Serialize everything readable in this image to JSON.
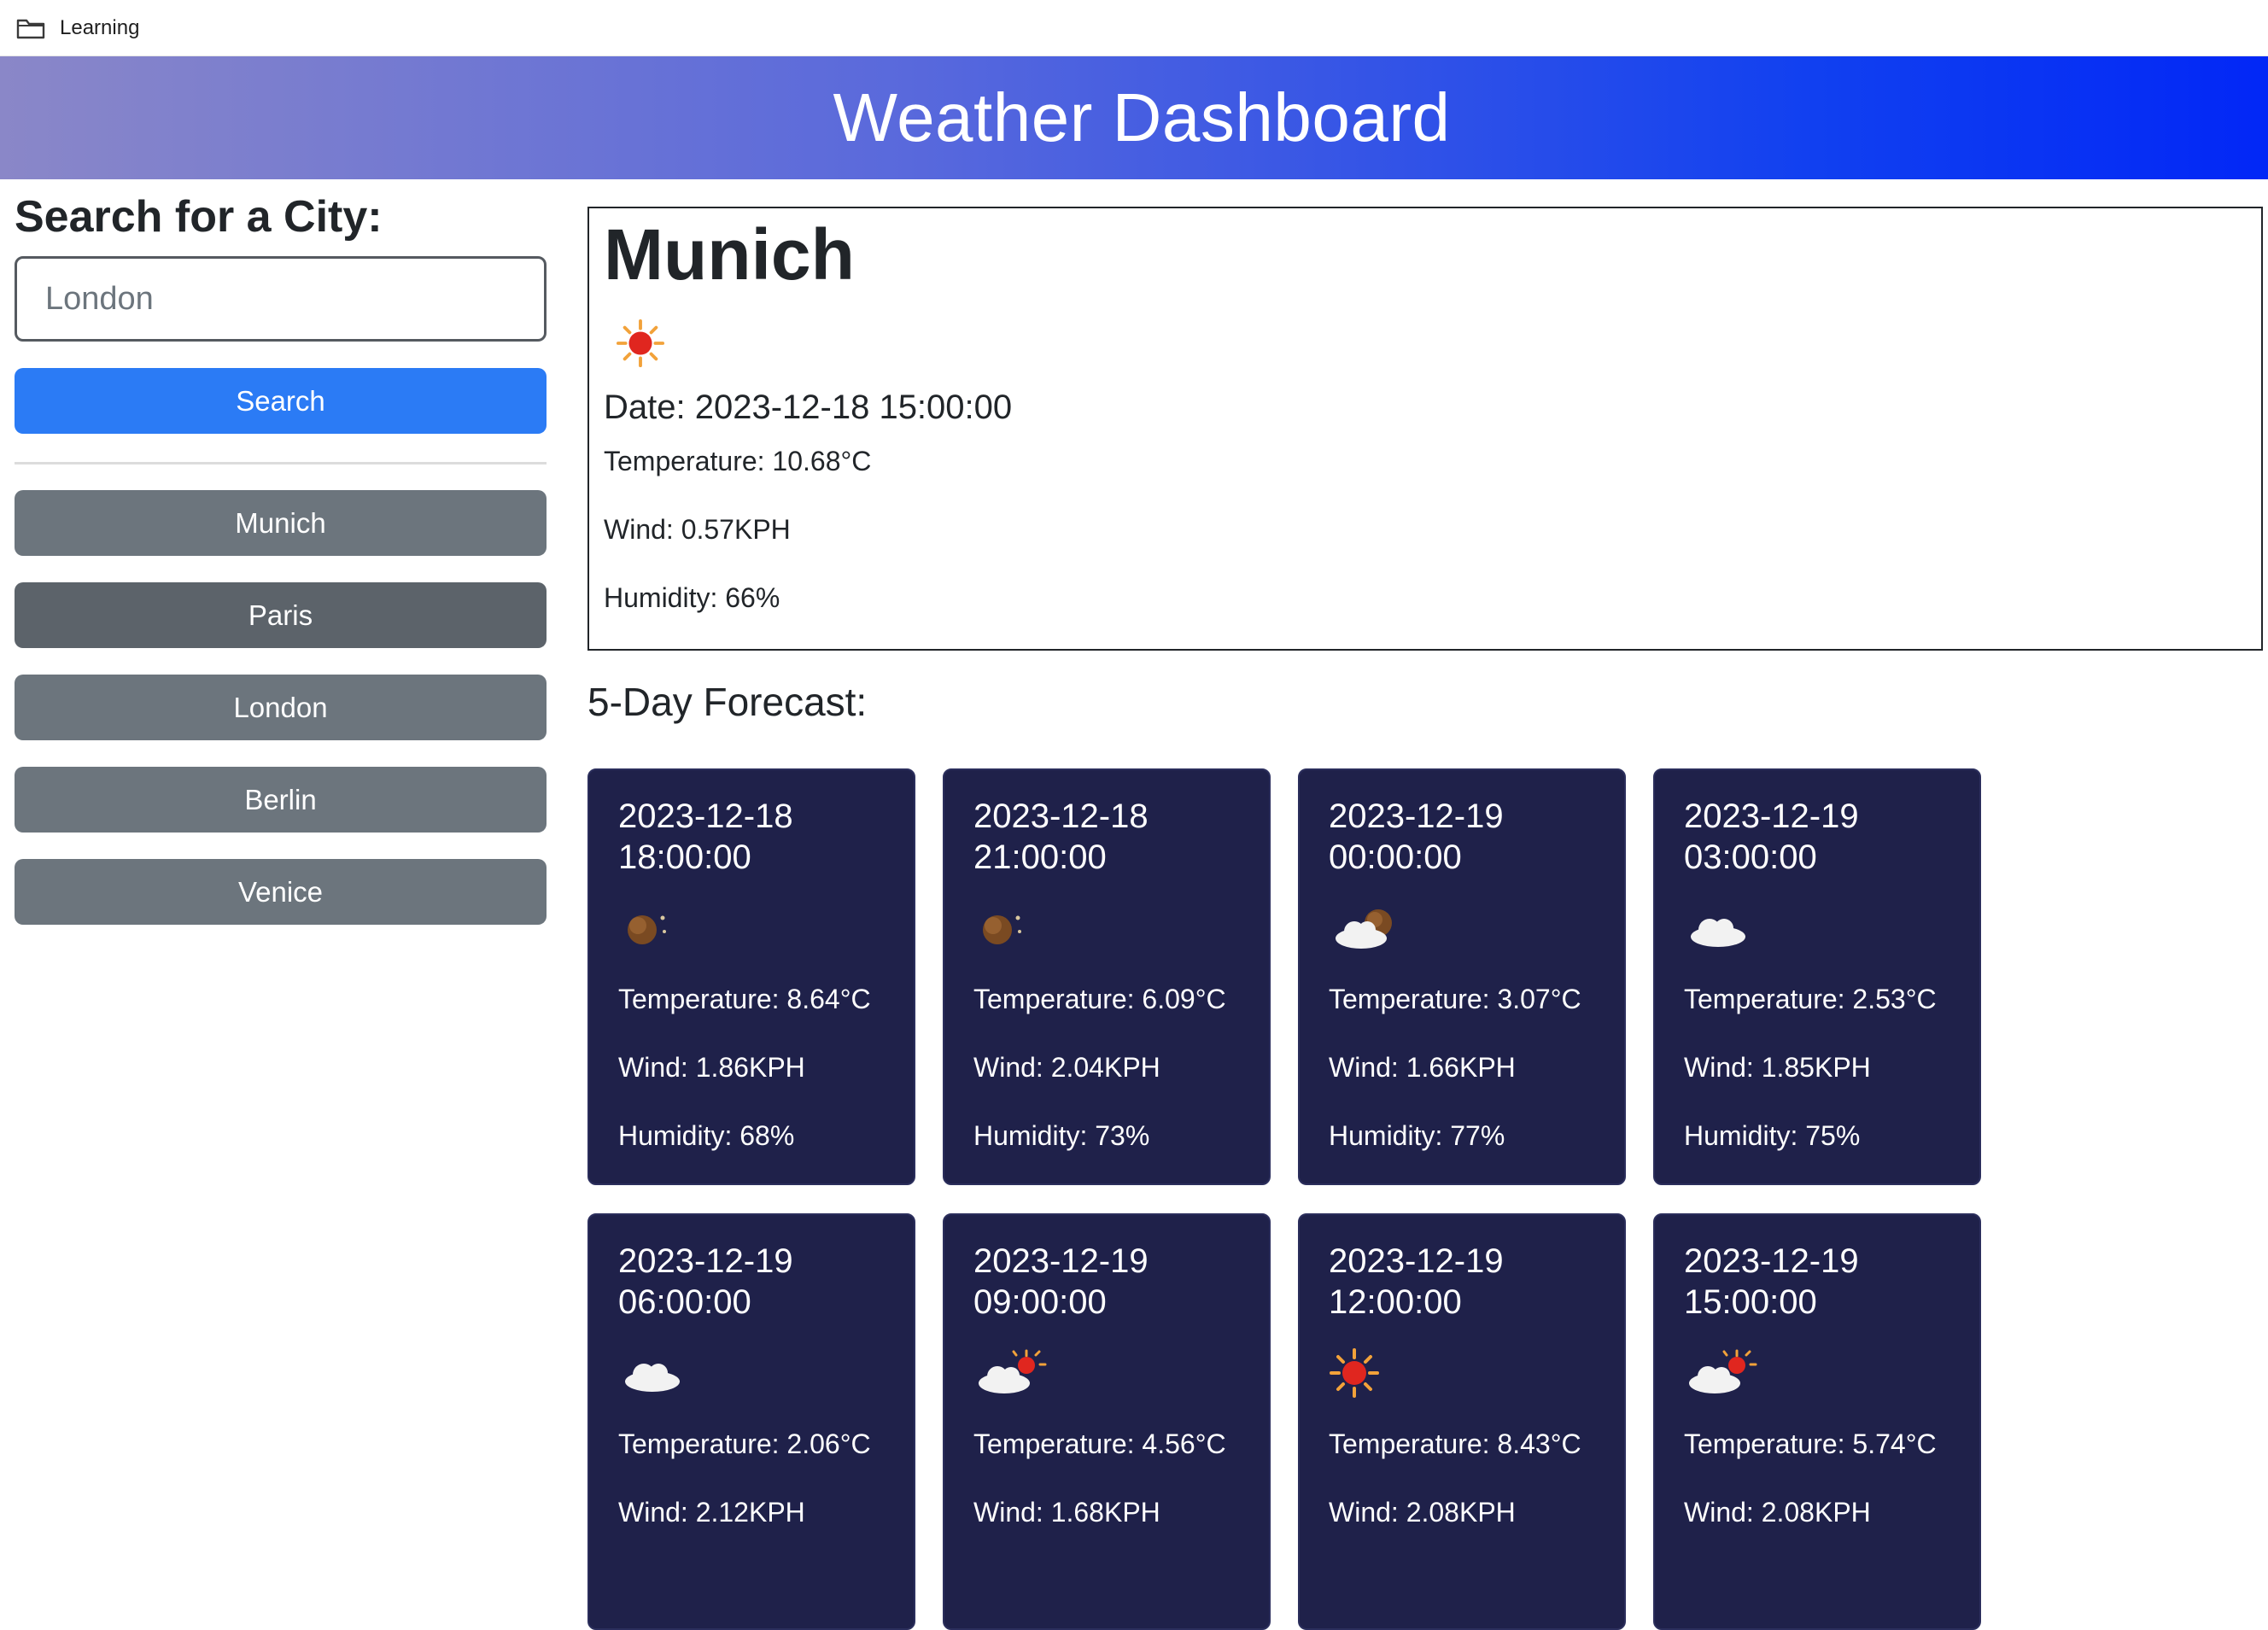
{
  "topbar": {
    "label": "Learning"
  },
  "header": {
    "title": "Weather Dashboard"
  },
  "sidebar": {
    "heading": "Search for a City:",
    "search_placeholder": "London",
    "search_button": "Search",
    "history": [
      "Munich",
      "Paris",
      "London",
      "Berlin",
      "Venice"
    ]
  },
  "current": {
    "city": "Munich",
    "icon": "sun-icon",
    "date": "Date: 2023-12-18 15:00:00",
    "temperature": "Temperature: 10.68°C",
    "wind": "Wind: 0.57KPH",
    "humidity": "Humidity: 66%"
  },
  "forecast": {
    "title": "5-Day Forecast:",
    "cards": [
      {
        "date": "2023-12-18 18:00:00",
        "icon": "moon-icon",
        "temperature": "Temperature: 8.64°C",
        "wind": "Wind: 1.86KPH",
        "humidity": "Humidity: 68%"
      },
      {
        "date": "2023-12-18 21:00:00",
        "icon": "moon-icon",
        "temperature": "Temperature: 6.09°C",
        "wind": "Wind: 2.04KPH",
        "humidity": "Humidity: 73%"
      },
      {
        "date": "2023-12-19 00:00:00",
        "icon": "cloud-moon-icon",
        "temperature": "Temperature: 3.07°C",
        "wind": "Wind: 1.66KPH",
        "humidity": "Humidity: 77%"
      },
      {
        "date": "2023-12-19 03:00:00",
        "icon": "cloud-icon",
        "temperature": "Temperature: 2.53°C",
        "wind": "Wind: 1.85KPH",
        "humidity": "Humidity: 75%"
      },
      {
        "date": "2023-12-19 06:00:00",
        "icon": "cloud-icon",
        "temperature": "Temperature: 2.06°C",
        "wind": "Wind: 2.12KPH",
        "humidity": ""
      },
      {
        "date": "2023-12-19 09:00:00",
        "icon": "cloud-sun-icon",
        "temperature": "Temperature: 4.56°C",
        "wind": "Wind: 1.68KPH",
        "humidity": ""
      },
      {
        "date": "2023-12-19 12:00:00",
        "icon": "sun-icon",
        "temperature": "Temperature: 8.43°C",
        "wind": "Wind: 2.08KPH",
        "humidity": ""
      },
      {
        "date": "2023-12-19 15:00:00",
        "icon": "cloud-sun-icon",
        "temperature": "Temperature: 5.74°C",
        "wind": "Wind: 2.08KPH",
        "humidity": ""
      }
    ]
  },
  "colors": {
    "accent": "#2b7bf5",
    "secondary": "#6c757d",
    "card_bg": "#1f214a",
    "header_start": "#8a87c8",
    "header_end": "#0227f6"
  }
}
